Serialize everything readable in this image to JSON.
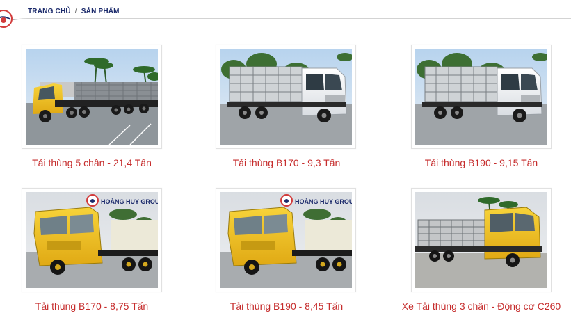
{
  "breadcrumb": {
    "home": "TRANG CHỦ",
    "separator": "/",
    "current": "SẢN PHẨM"
  },
  "products": [
    {
      "title": "Tải thùng 5 chân - 21,4 Tấn",
      "cab_color": "yellow",
      "image_id": "dump-yellow"
    },
    {
      "title": "Tải thùng B170 - 9,3 Tấn",
      "cab_color": "white",
      "image_id": "white-truck"
    },
    {
      "title": "Tải thùng B190 - 9,15 Tấn",
      "cab_color": "white",
      "image_id": "white-truck"
    },
    {
      "title": "Tải thùng B170 - 8,75 Tấn",
      "cab_color": "yellow",
      "image_id": "chassis-yellow",
      "badge_text": "HOÀNG HUY GROUP"
    },
    {
      "title": "Tải thùng B190 - 8,45 Tấn",
      "cab_color": "yellow",
      "image_id": "chassis-yellow",
      "badge_text": "HOÀNG HUY GROUP"
    },
    {
      "title": "Xe Tải thùng 3 chân - Động cơ C260",
      "cab_color": "yellow",
      "image_id": "cargo-yellow"
    }
  ],
  "colors": {
    "title_red": "#c62d2d",
    "breadcrumb_navy": "#1b2a6b",
    "truck_yellow": "#f2c31c",
    "sky_blue": "#a9c8e6"
  }
}
